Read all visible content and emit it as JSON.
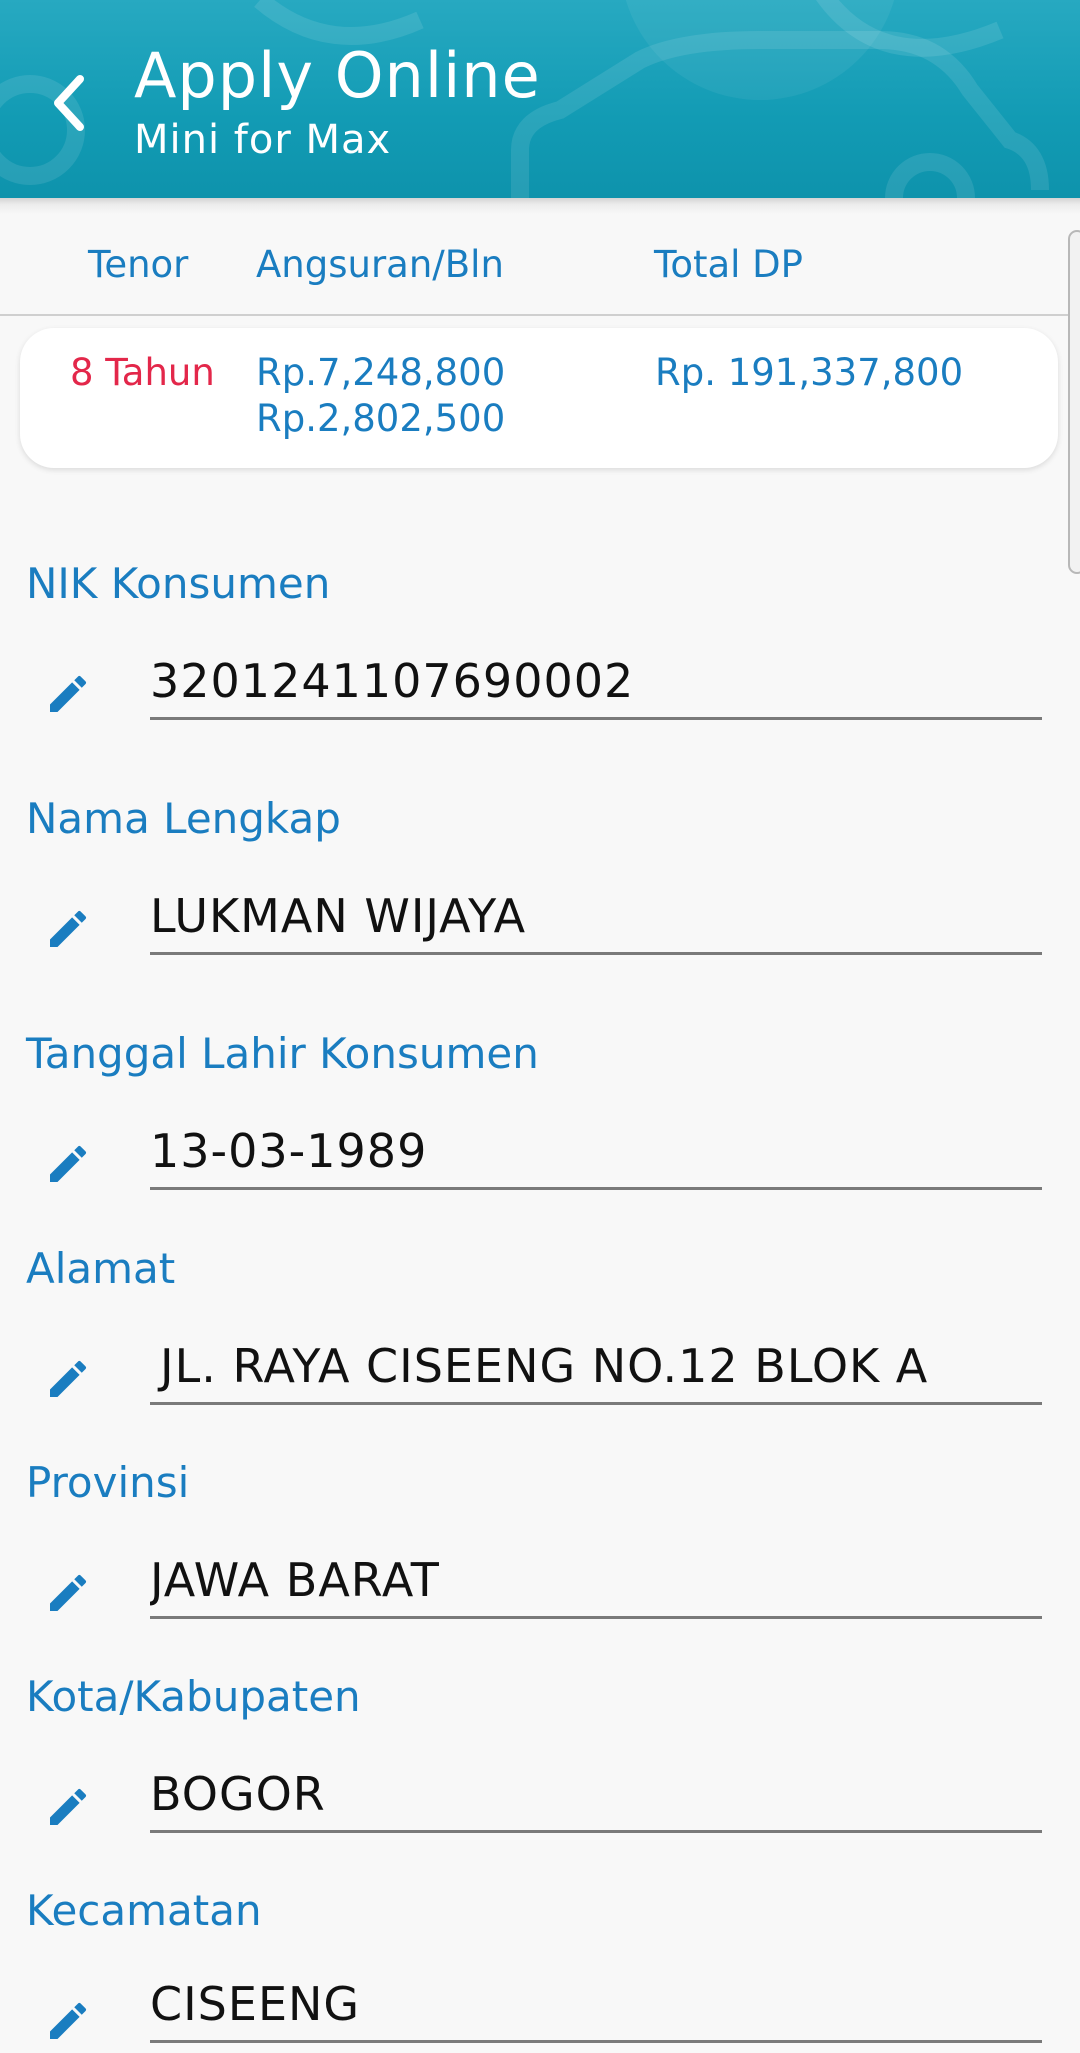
{
  "header": {
    "title": "Apply Online",
    "subtitle": "Mini for Max"
  },
  "colors": {
    "header_bg": "#129bb4",
    "accent_blue": "#1a7dc0",
    "tenor_red": "#e3274a",
    "background": "#f8f8f8"
  },
  "summary": {
    "columns": [
      "Tenor",
      "Angsuran/Bln",
      "Total DP"
    ],
    "row": {
      "tenor": "8 Tahun",
      "angsuran_1": "Rp.7,248,800",
      "angsuran_2": "Rp.2,802,500",
      "total_dp": "Rp. 191,337,800"
    }
  },
  "form": {
    "fields": [
      {
        "label": "NIK Konsumen",
        "value": "3201241107690002",
        "icon": "pencil-icon"
      },
      {
        "label": "Nama Lengkap",
        "value": "LUKMAN WIJAYA",
        "icon": "pencil-icon"
      },
      {
        "label": "Tanggal Lahir Konsumen",
        "value": "13-03-1989",
        "icon": "pencil-icon"
      },
      {
        "label": "Alamat",
        "value": "JL. RAYA CISEENG NO.12 BLOK A",
        "icon": "pencil-icon"
      },
      {
        "label": "Provinsi",
        "value": "JAWA BARAT",
        "icon": "pencil-icon"
      },
      {
        "label": "Kota/Kabupaten",
        "value": "BOGOR",
        "icon": "pencil-icon"
      },
      {
        "label": "Kecamatan",
        "value": "CISEENG",
        "icon": "pencil-icon"
      }
    ]
  },
  "icons": {
    "back": "chevron-left-icon",
    "edit": "pencil-icon"
  }
}
